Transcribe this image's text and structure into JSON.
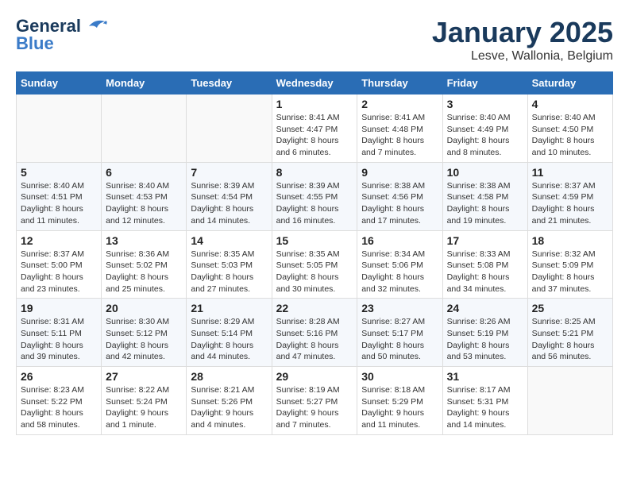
{
  "logo": {
    "text1": "General",
    "text2": "Blue"
  },
  "title": "January 2025",
  "subtitle": "Lesve, Wallonia, Belgium",
  "days_of_week": [
    "Sunday",
    "Monday",
    "Tuesday",
    "Wednesday",
    "Thursday",
    "Friday",
    "Saturday"
  ],
  "weeks": [
    [
      {
        "day": "",
        "info": ""
      },
      {
        "day": "",
        "info": ""
      },
      {
        "day": "",
        "info": ""
      },
      {
        "day": "1",
        "info": "Sunrise: 8:41 AM\nSunset: 4:47 PM\nDaylight: 8 hours\nand 6 minutes."
      },
      {
        "day": "2",
        "info": "Sunrise: 8:41 AM\nSunset: 4:48 PM\nDaylight: 8 hours\nand 7 minutes."
      },
      {
        "day": "3",
        "info": "Sunrise: 8:40 AM\nSunset: 4:49 PM\nDaylight: 8 hours\nand 8 minutes."
      },
      {
        "day": "4",
        "info": "Sunrise: 8:40 AM\nSunset: 4:50 PM\nDaylight: 8 hours\nand 10 minutes."
      }
    ],
    [
      {
        "day": "5",
        "info": "Sunrise: 8:40 AM\nSunset: 4:51 PM\nDaylight: 8 hours\nand 11 minutes."
      },
      {
        "day": "6",
        "info": "Sunrise: 8:40 AM\nSunset: 4:53 PM\nDaylight: 8 hours\nand 12 minutes."
      },
      {
        "day": "7",
        "info": "Sunrise: 8:39 AM\nSunset: 4:54 PM\nDaylight: 8 hours\nand 14 minutes."
      },
      {
        "day": "8",
        "info": "Sunrise: 8:39 AM\nSunset: 4:55 PM\nDaylight: 8 hours\nand 16 minutes."
      },
      {
        "day": "9",
        "info": "Sunrise: 8:38 AM\nSunset: 4:56 PM\nDaylight: 8 hours\nand 17 minutes."
      },
      {
        "day": "10",
        "info": "Sunrise: 8:38 AM\nSunset: 4:58 PM\nDaylight: 8 hours\nand 19 minutes."
      },
      {
        "day": "11",
        "info": "Sunrise: 8:37 AM\nSunset: 4:59 PM\nDaylight: 8 hours\nand 21 minutes."
      }
    ],
    [
      {
        "day": "12",
        "info": "Sunrise: 8:37 AM\nSunset: 5:00 PM\nDaylight: 8 hours\nand 23 minutes."
      },
      {
        "day": "13",
        "info": "Sunrise: 8:36 AM\nSunset: 5:02 PM\nDaylight: 8 hours\nand 25 minutes."
      },
      {
        "day": "14",
        "info": "Sunrise: 8:35 AM\nSunset: 5:03 PM\nDaylight: 8 hours\nand 27 minutes."
      },
      {
        "day": "15",
        "info": "Sunrise: 8:35 AM\nSunset: 5:05 PM\nDaylight: 8 hours\nand 30 minutes."
      },
      {
        "day": "16",
        "info": "Sunrise: 8:34 AM\nSunset: 5:06 PM\nDaylight: 8 hours\nand 32 minutes."
      },
      {
        "day": "17",
        "info": "Sunrise: 8:33 AM\nSunset: 5:08 PM\nDaylight: 8 hours\nand 34 minutes."
      },
      {
        "day": "18",
        "info": "Sunrise: 8:32 AM\nSunset: 5:09 PM\nDaylight: 8 hours\nand 37 minutes."
      }
    ],
    [
      {
        "day": "19",
        "info": "Sunrise: 8:31 AM\nSunset: 5:11 PM\nDaylight: 8 hours\nand 39 minutes."
      },
      {
        "day": "20",
        "info": "Sunrise: 8:30 AM\nSunset: 5:12 PM\nDaylight: 8 hours\nand 42 minutes."
      },
      {
        "day": "21",
        "info": "Sunrise: 8:29 AM\nSunset: 5:14 PM\nDaylight: 8 hours\nand 44 minutes."
      },
      {
        "day": "22",
        "info": "Sunrise: 8:28 AM\nSunset: 5:16 PM\nDaylight: 8 hours\nand 47 minutes."
      },
      {
        "day": "23",
        "info": "Sunrise: 8:27 AM\nSunset: 5:17 PM\nDaylight: 8 hours\nand 50 minutes."
      },
      {
        "day": "24",
        "info": "Sunrise: 8:26 AM\nSunset: 5:19 PM\nDaylight: 8 hours\nand 53 minutes."
      },
      {
        "day": "25",
        "info": "Sunrise: 8:25 AM\nSunset: 5:21 PM\nDaylight: 8 hours\nand 56 minutes."
      }
    ],
    [
      {
        "day": "26",
        "info": "Sunrise: 8:23 AM\nSunset: 5:22 PM\nDaylight: 8 hours\nand 58 minutes."
      },
      {
        "day": "27",
        "info": "Sunrise: 8:22 AM\nSunset: 5:24 PM\nDaylight: 9 hours\nand 1 minute."
      },
      {
        "day": "28",
        "info": "Sunrise: 8:21 AM\nSunset: 5:26 PM\nDaylight: 9 hours\nand 4 minutes."
      },
      {
        "day": "29",
        "info": "Sunrise: 8:19 AM\nSunset: 5:27 PM\nDaylight: 9 hours\nand 7 minutes."
      },
      {
        "day": "30",
        "info": "Sunrise: 8:18 AM\nSunset: 5:29 PM\nDaylight: 9 hours\nand 11 minutes."
      },
      {
        "day": "31",
        "info": "Sunrise: 8:17 AM\nSunset: 5:31 PM\nDaylight: 9 hours\nand 14 minutes."
      },
      {
        "day": "",
        "info": ""
      }
    ]
  ]
}
